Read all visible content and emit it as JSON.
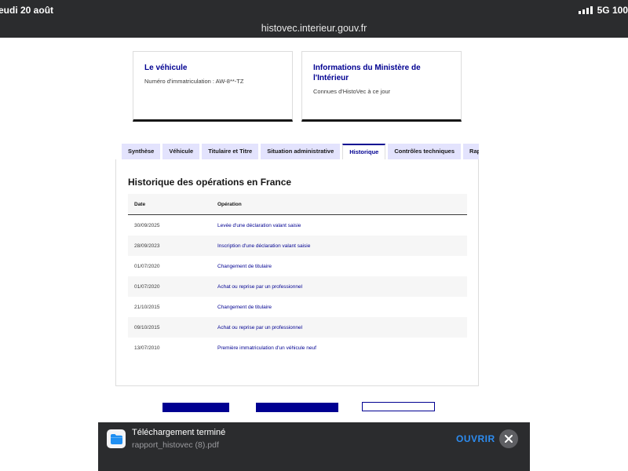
{
  "status_bar": {
    "time": "eudi 20 août",
    "network": "5G",
    "battery": "100"
  },
  "address_bar": {
    "url": "histovec.interieur.gouv.fr"
  },
  "cards": {
    "vehicle": {
      "title": "Le véhicule",
      "subtitle": "Numéro d'immatriculation : AW-8**-TZ"
    },
    "ministry": {
      "title": "Informations du Ministère de l'Intérieur",
      "subtitle": "Connues d'HistoVec à ce jour"
    }
  },
  "tabs": [
    {
      "label": "Synthèse",
      "active": false
    },
    {
      "label": "Véhicule",
      "active": false
    },
    {
      "label": "Titulaire et Titre",
      "active": false
    },
    {
      "label": "Situation administrative",
      "active": false
    },
    {
      "label": "Historique",
      "active": true
    },
    {
      "label": "Contrôles techniques",
      "active": false
    },
    {
      "label": "Rap",
      "active": false
    }
  ],
  "history": {
    "title": "Historique des opérations en France",
    "columns": {
      "date": "Date",
      "operation": "Opération"
    },
    "rows": [
      {
        "date": "30/09/2025",
        "operation": "Levée d'une déclaration valant saisie"
      },
      {
        "date": "28/09/2023",
        "operation": "Inscription d'une déclaration valant saisie"
      },
      {
        "date": "01/07/2020",
        "operation": "Changement de titulaire"
      },
      {
        "date": "01/07/2020",
        "operation": "Achat ou reprise par un professionnel"
      },
      {
        "date": "21/10/2015",
        "operation": "Changement de titulaire"
      },
      {
        "date": "09/10/2015",
        "operation": "Achat ou reprise par un professionnel"
      },
      {
        "date": "13/07/2010",
        "operation": "Première immatriculation d'un véhicule neuf"
      }
    ]
  },
  "download_toast": {
    "title": "Téléchargement terminé",
    "filename": "rapport_histovec (8).pdf",
    "open_label": "OUVRIR",
    "icon": "folder-icon"
  },
  "colors": {
    "accent": "#000091",
    "tab_bg": "#e3e3fd",
    "toast_link": "#2d8cf0"
  }
}
